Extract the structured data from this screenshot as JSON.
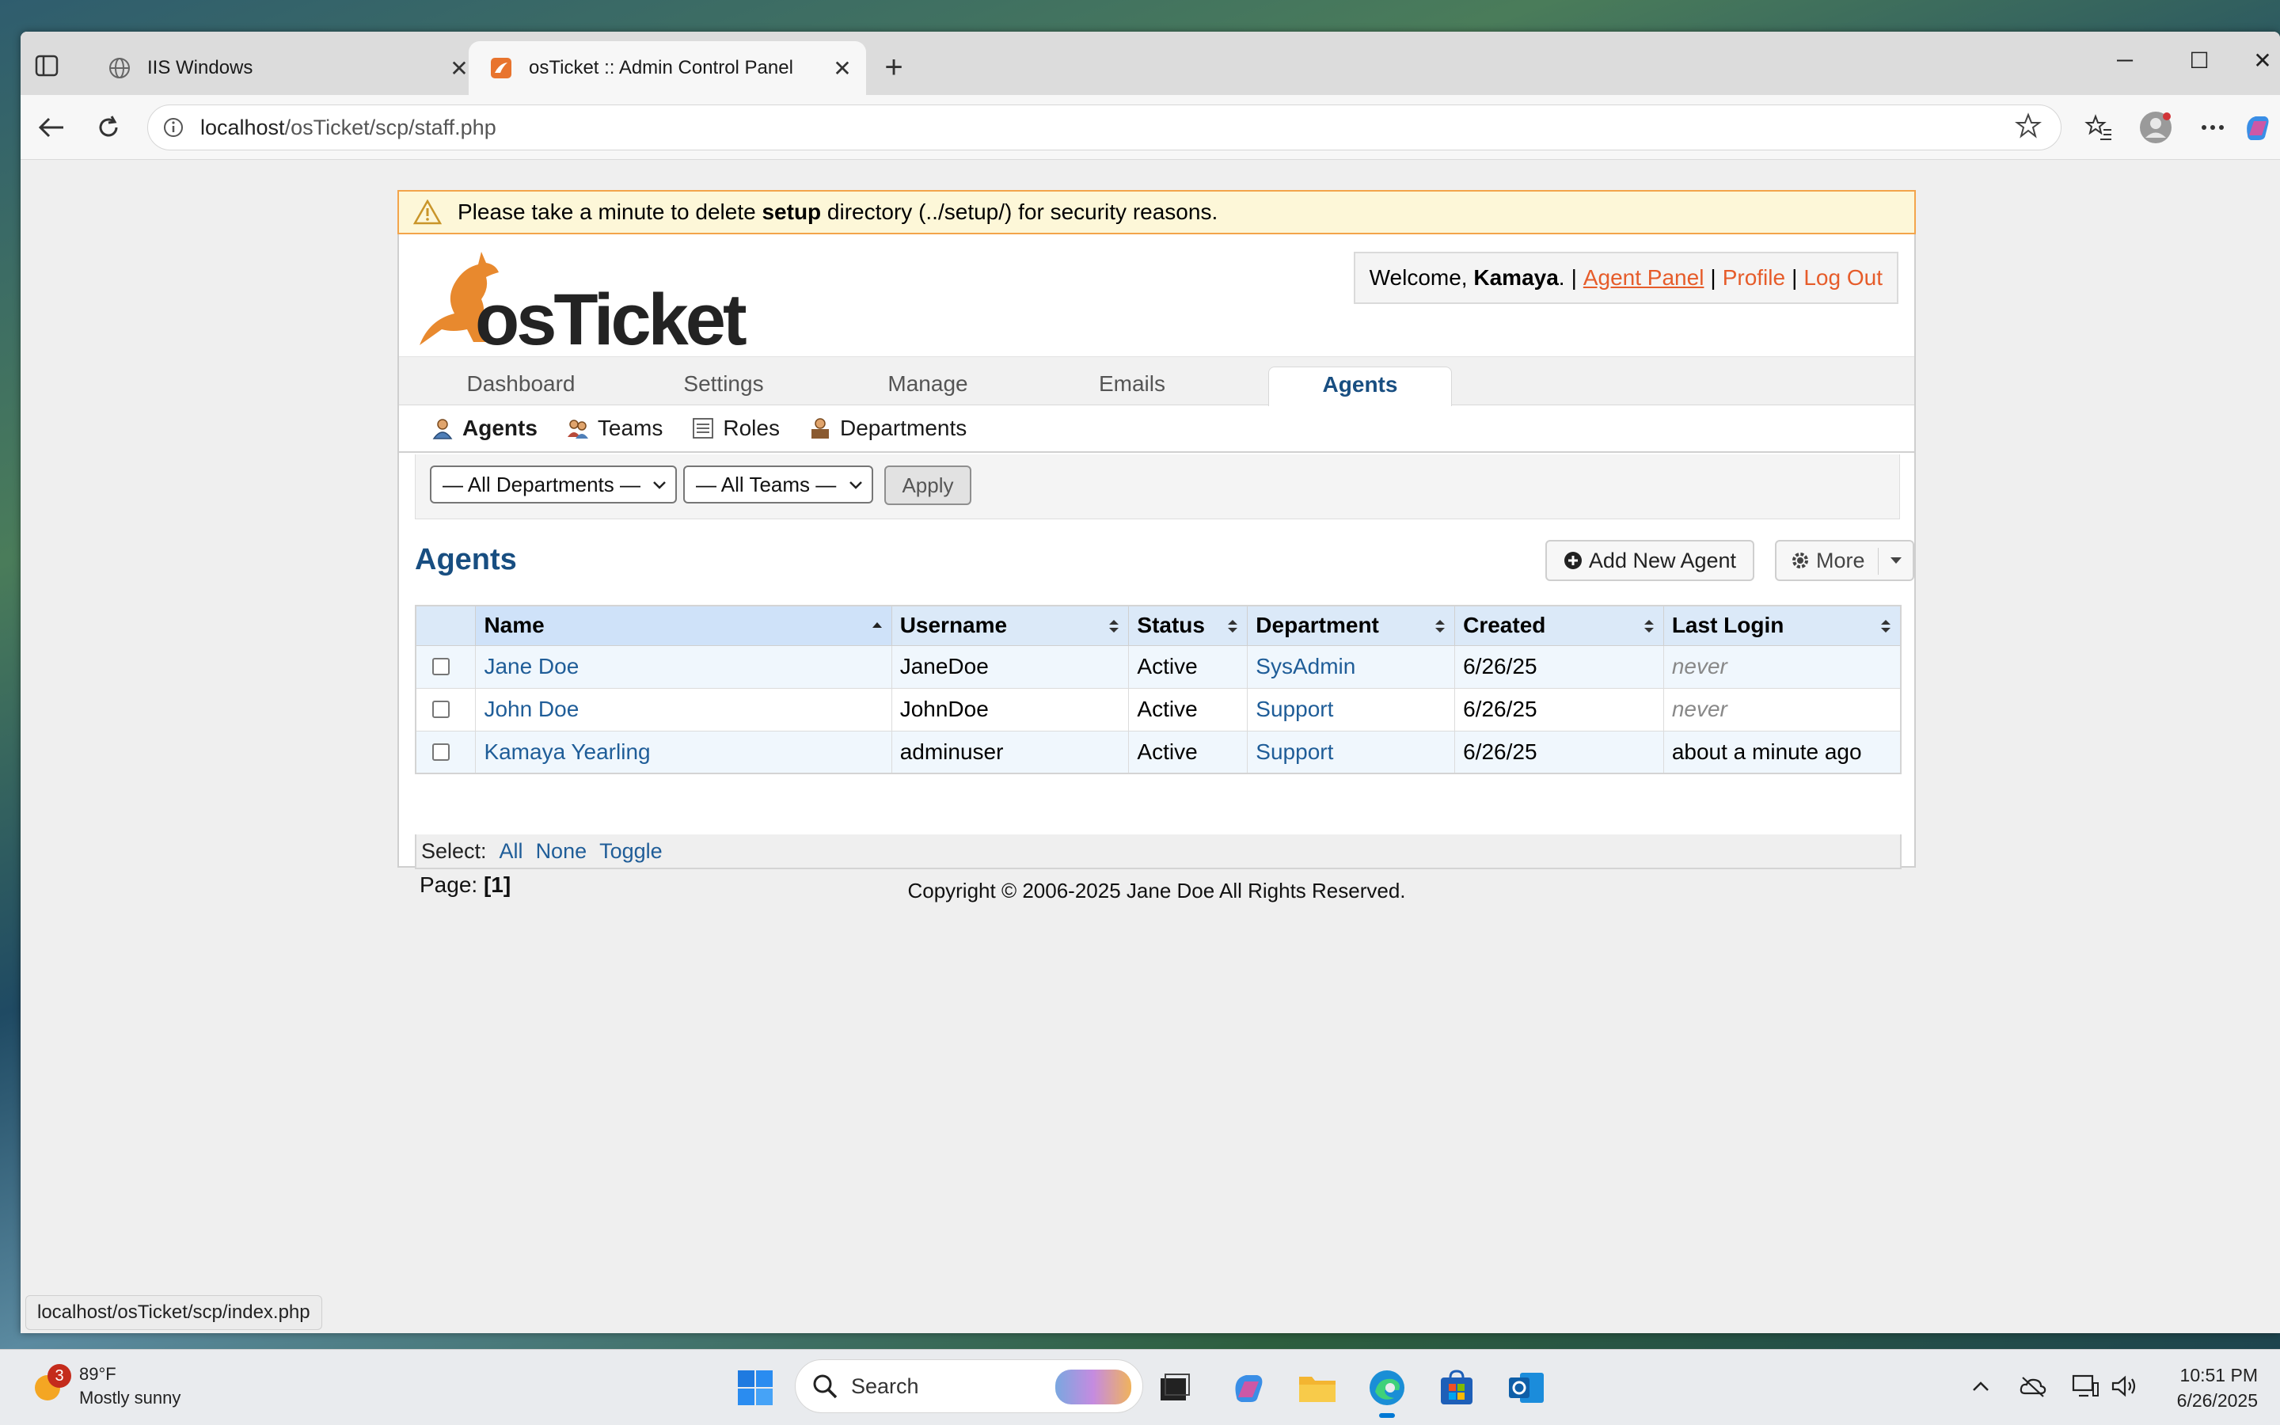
{
  "browser": {
    "tabs": [
      {
        "title": "IIS Windows",
        "active": false
      },
      {
        "title": "osTicket :: Admin Control Panel",
        "active": true
      }
    ],
    "address": {
      "host": "localhost",
      "path": "/osTicket/scp/staff.php"
    },
    "status_url": "localhost/osTicket/scp/index.php"
  },
  "warning": {
    "prefix": "Please take a minute to delete ",
    "bold": "setup",
    "suffix": " directory (../setup/) for security reasons."
  },
  "logo": {
    "text": "osTicket"
  },
  "welcome": {
    "greeting": "Welcome, ",
    "user": "Kamaya",
    "after_user": ".",
    "agent_panel": "Agent Panel",
    "profile": "Profile",
    "logout": "Log Out",
    "separator": "|"
  },
  "nav": {
    "items": [
      "Dashboard",
      "Settings",
      "Manage",
      "Emails",
      "Agents"
    ],
    "active": "Agents"
  },
  "subnav": {
    "items": [
      "Agents",
      "Teams",
      "Roles",
      "Departments"
    ]
  },
  "filters": {
    "department": "— All Departments —",
    "team": "— All Teams —",
    "apply": "Apply"
  },
  "agents": {
    "title": "Agents",
    "add_new": "Add New Agent",
    "more": "More",
    "columns": [
      "Name",
      "Username",
      "Status",
      "Department",
      "Created",
      "Last Login"
    ],
    "rows": [
      {
        "name": "Jane Doe",
        "username": "JaneDoe",
        "status": "Active",
        "department": "SysAdmin",
        "created": "6/26/25",
        "last_login": "never"
      },
      {
        "name": "John Doe",
        "username": "JohnDoe",
        "status": "Active",
        "department": "Support",
        "created": "6/26/25",
        "last_login": "never"
      },
      {
        "name": "Kamaya Yearling",
        "username": "adminuser",
        "status": "Active",
        "department": "Support",
        "created": "6/26/25",
        "last_login": "about a minute ago"
      }
    ],
    "select_label": "Select:",
    "select_all": "All",
    "select_none": "None",
    "select_toggle": "Toggle",
    "page_label": "Page:",
    "page_current": "[1]"
  },
  "footer": "Copyright © 2006-2025 Jane Doe All Rights Reserved.",
  "taskbar": {
    "weather_temp": "89°F",
    "weather_desc": "Mostly sunny",
    "weather_badge": "3",
    "search_placeholder": "Search",
    "time": "10:51 PM",
    "date": "6/26/2025"
  },
  "colors": {
    "accent_link": "#e65c2a",
    "nav_active": "#184e81",
    "table_link": "#1f5d98",
    "warning_bg": "#fdf7d8",
    "warning_border": "#f3a44b"
  }
}
